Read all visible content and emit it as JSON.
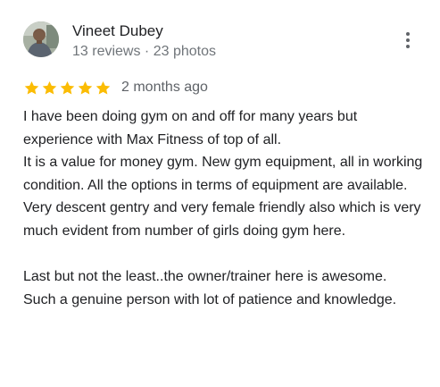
{
  "review": {
    "reviewer": {
      "name": "Vineet Dubey",
      "meta": "13 reviews · 23 photos",
      "avatar_icon": "reviewer-avatar-photo"
    },
    "more_options_icon": "more-vert-icon",
    "rating": {
      "stars": 5,
      "max_stars": 5,
      "star_color": "#fbbc04",
      "date": "2 months ago"
    },
    "text": "I have been doing gym on and off for many years but experience with Max Fitness of top of all.\nIt is a value for money gym. New gym equipment, all in working condition. All the options in terms of equipment are available. Very descent gentry and very female friendly also which is very much evident from number of girls doing gym here.\n\nLast but not the least..the owner/trainer here is awesome.\nSuch a genuine person with lot of patience and knowledge."
  }
}
